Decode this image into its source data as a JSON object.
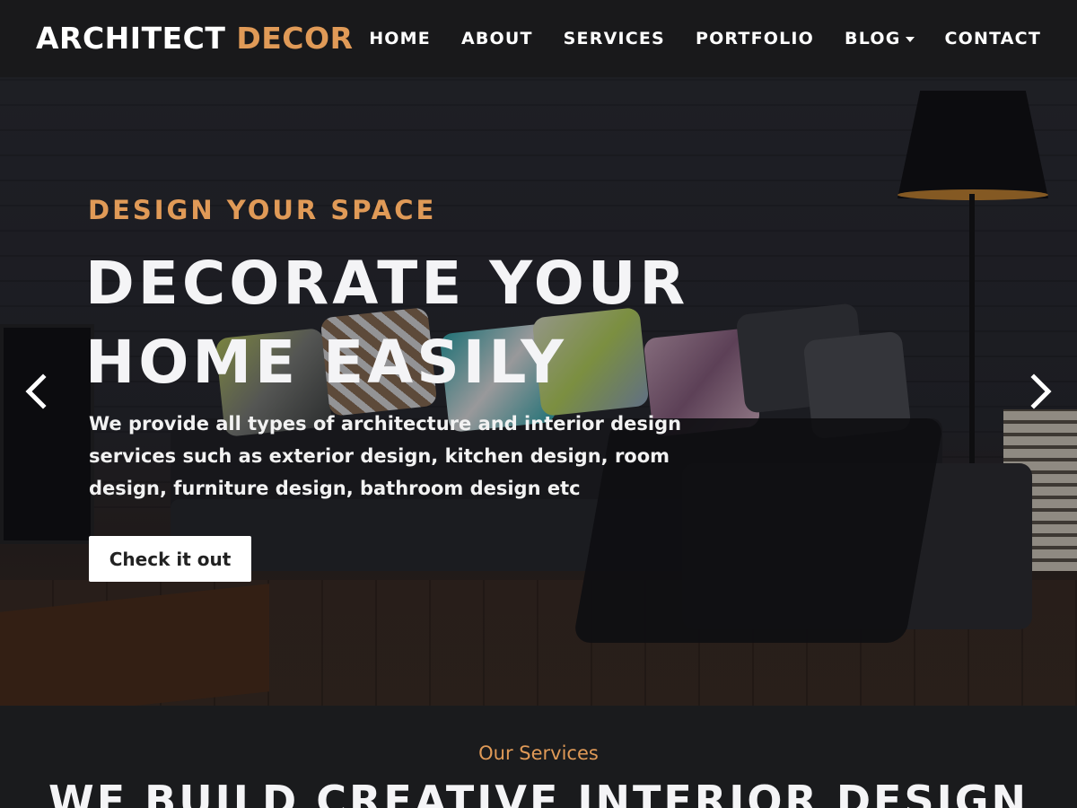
{
  "header": {
    "logo_part1": "ARCHITECT",
    "logo_part2": "DECOR",
    "nav": [
      {
        "label": "HOME"
      },
      {
        "label": "ABOUT"
      },
      {
        "label": "SERVICES"
      },
      {
        "label": "PORTFOLIO"
      },
      {
        "label": "BLOG"
      },
      {
        "label": "CONTACT"
      }
    ]
  },
  "hero": {
    "subtitle": "DESIGN YOUR SPACE",
    "title": "DECORATE YOUR HOME EASILY",
    "description": "We provide all types of architecture and interior design services such as exterior design, kitchen design, room design, furniture design, bathroom design etc",
    "button_label": "Check it out",
    "prev_icon": "chevron-left-icon",
    "next_icon": "chevron-right-icon"
  },
  "services": {
    "label": "Our Services",
    "heading": "WE BUILD CREATIVE INTERIOR DESIGN"
  },
  "colors": {
    "accent": "#e09a57",
    "header_bg": "#19191b",
    "page_bg": "#1a1b1d",
    "button_bg": "#ffffff"
  }
}
